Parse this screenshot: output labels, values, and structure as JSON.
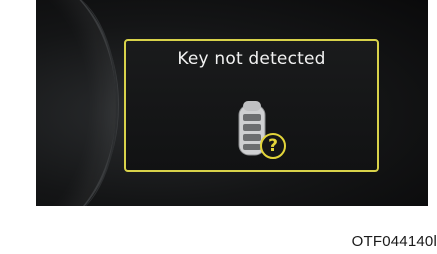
{
  "message": {
    "text": "Key not detected",
    "icon": "smart-key-fob-icon",
    "badge_symbol": "?",
    "badge_icon": "question-mark-icon"
  },
  "caption": {
    "code": "OTF044140l"
  },
  "colors": {
    "accent_yellow": "#d8d24a",
    "screen_background": "#141516",
    "text": "#f2f2f2"
  }
}
